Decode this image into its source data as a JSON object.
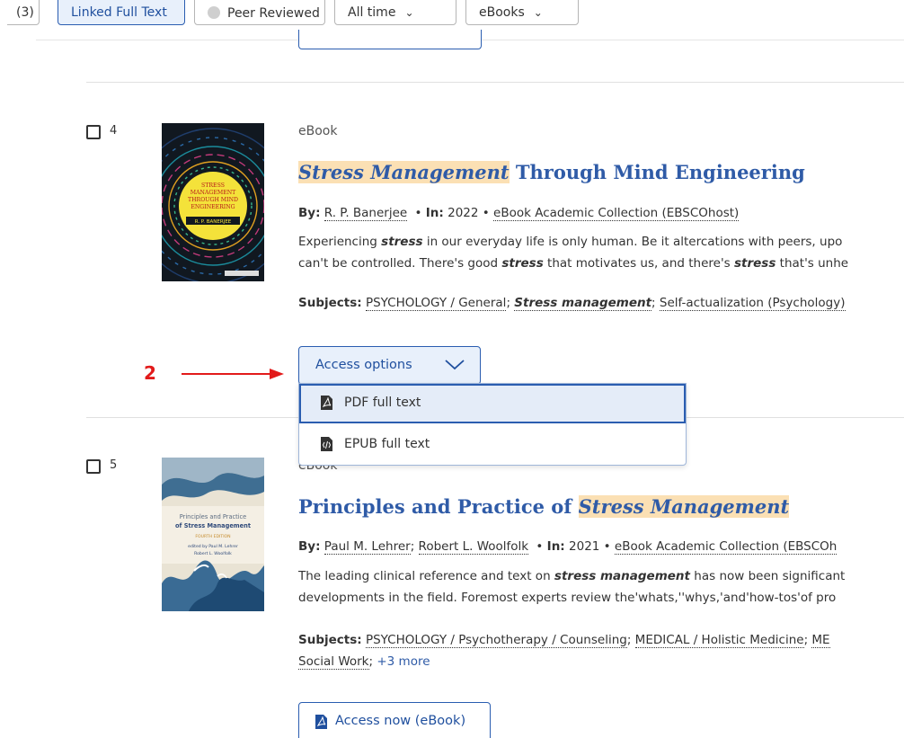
{
  "filters": {
    "count_chip": "(3)",
    "full_text_chip": "Linked Full Text",
    "peer_chip": "Peer Reviewed",
    "time_chip": "All time",
    "type_chip": "eBooks"
  },
  "results": [
    {
      "number": "4",
      "type": "eBook",
      "title_highlight": "Stress Management",
      "title_rest": " Through Mind Engineering",
      "by_label": "By:",
      "authors": [
        "R. P. Banerjee"
      ],
      "in_label": "• In:",
      "year": "2022",
      "collection": "eBook Academic Collection (EBSCOhost)",
      "abstract_line1_pre": "Experiencing ",
      "abstract_line1_em": "stress",
      "abstract_line1_post": " in our everyday life is only human. Be it altercations with peers, upo",
      "abstract_line2_pre": "can't be controlled. There's good ",
      "abstract_line2_em1": "stress",
      "abstract_line2_mid": " that motivates us, and there's ",
      "abstract_line2_em2": "stress",
      "abstract_line2_post": " that's unhe",
      "subjects_label": "Subjects:",
      "subject1": "PSYCHOLOGY / General",
      "subject2": "Stress management",
      "subject3": "Self-actualization (Psychology)",
      "cover": {
        "title_lines": [
          "STRESS",
          "MANAGEMENT",
          "THROUGH MIND",
          "ENGINEERING"
        ],
        "author": "R. P. BANERJEE",
        "bg": "#111820",
        "accent": "#f4e23a"
      }
    },
    {
      "number": "5",
      "type": "eBook",
      "title_pre": "Principles and Practice of ",
      "title_highlight": "Stress Management",
      "by_label": "By:",
      "authors": [
        "Paul M. Lehrer",
        "Robert L. Woolfolk"
      ],
      "in_label": "• In:",
      "year": "2021",
      "collection": "eBook Academic Collection (EBSCOh",
      "abstract_line1_pre": "The leading clinical reference and text on ",
      "abstract_line1_em": "stress management",
      "abstract_line1_post": " has now been significant",
      "abstract_line2": "developments in the field. Foremost experts review the'whats,''whys,'and'how-tos'of pro",
      "subjects_label": "Subjects:",
      "subject1": "PSYCHOLOGY / Psychotherapy / Counseling",
      "subject2": "MEDICAL / Holistic Medicine",
      "subject3": "ME",
      "subject4": "Social Work",
      "more": "+3 more",
      "cover": {
        "title_lines": [
          "Principles and Practice",
          "of Stress Management"
        ],
        "edition": "FOURTH EDITION",
        "editors": [
          "edited by Paul M. Lehrer",
          "Robert L. Woolfolk"
        ]
      }
    }
  ],
  "access_options": {
    "label": "Access options",
    "menu": [
      "PDF full text",
      "EPUB full text"
    ]
  },
  "access_now": {
    "label": "Access now (eBook)"
  },
  "annotation": {
    "number": "2",
    "color": "#e21a1a"
  }
}
